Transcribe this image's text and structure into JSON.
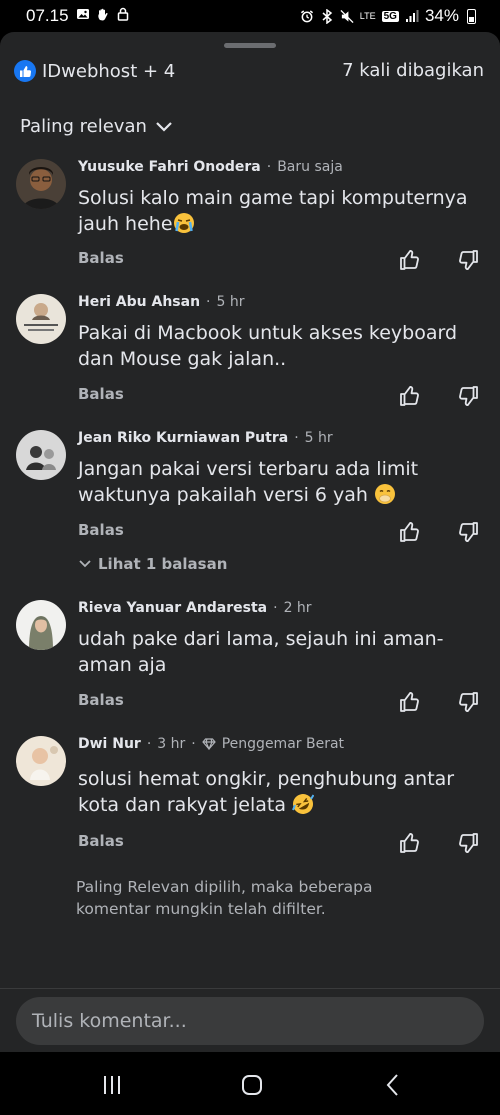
{
  "status_bar": {
    "time": "07.15",
    "network": "LTE",
    "network_extra": "5G",
    "battery": "34%",
    "icons": [
      "image-icon",
      "hand-icon",
      "lock-icon",
      "alarm-icon",
      "bluetooth-icon",
      "mute-icon",
      "signal-icon",
      "battery-icon"
    ]
  },
  "header": {
    "reactors": "IDwebhost + 4",
    "shares": "7 kali dibagikan",
    "sort_label": "Paling relevan"
  },
  "comments": [
    {
      "name": "Yuusuke Fahri Onodera",
      "time": "Baru saja",
      "text": "Solusi kalo main game tapi komputernya jauh hehe",
      "emoji": "loudly-crying-face",
      "reply": "Balas"
    },
    {
      "name": "Heri Abu Ahsan",
      "time": "5 hr",
      "text": "Pakai di Macbook untuk akses keyboard dan Mouse gak jalan..",
      "reply": "Balas"
    },
    {
      "name": "Jean Riko Kurniawan Putra",
      "time": "5 hr",
      "text": "Jangan pakai versi terbaru ada limit waktunya pakailah versi 6 yah",
      "emoji": "hand-over-mouth-face",
      "reply": "Balas",
      "view_replies": "Lihat 1 balasan"
    },
    {
      "name": "Rieva Yanuar Andaresta",
      "time": "2 hr",
      "text": "udah pake dari lama, sejauh ini aman-aman aja",
      "reply": "Balas"
    },
    {
      "name": "Dwi Nur",
      "time": "3 hr",
      "badge": "Penggemar Berat",
      "text": "solusi hemat ongkir, penghubung antar kota dan rakyat jelata",
      "emoji": "rolling-laughing-face",
      "reply": "Balas"
    }
  ],
  "footer_note": "Paling Relevan dipilih, maka beberapa komentar mungkin telah difilter.",
  "compose": {
    "placeholder": "Tulis komentar..."
  },
  "colors": {
    "sheet_bg": "#242526",
    "text": "#e4e6eb",
    "muted": "#b0b3b8",
    "accent": "#1877f2",
    "input_bg": "#3a3b3c"
  }
}
